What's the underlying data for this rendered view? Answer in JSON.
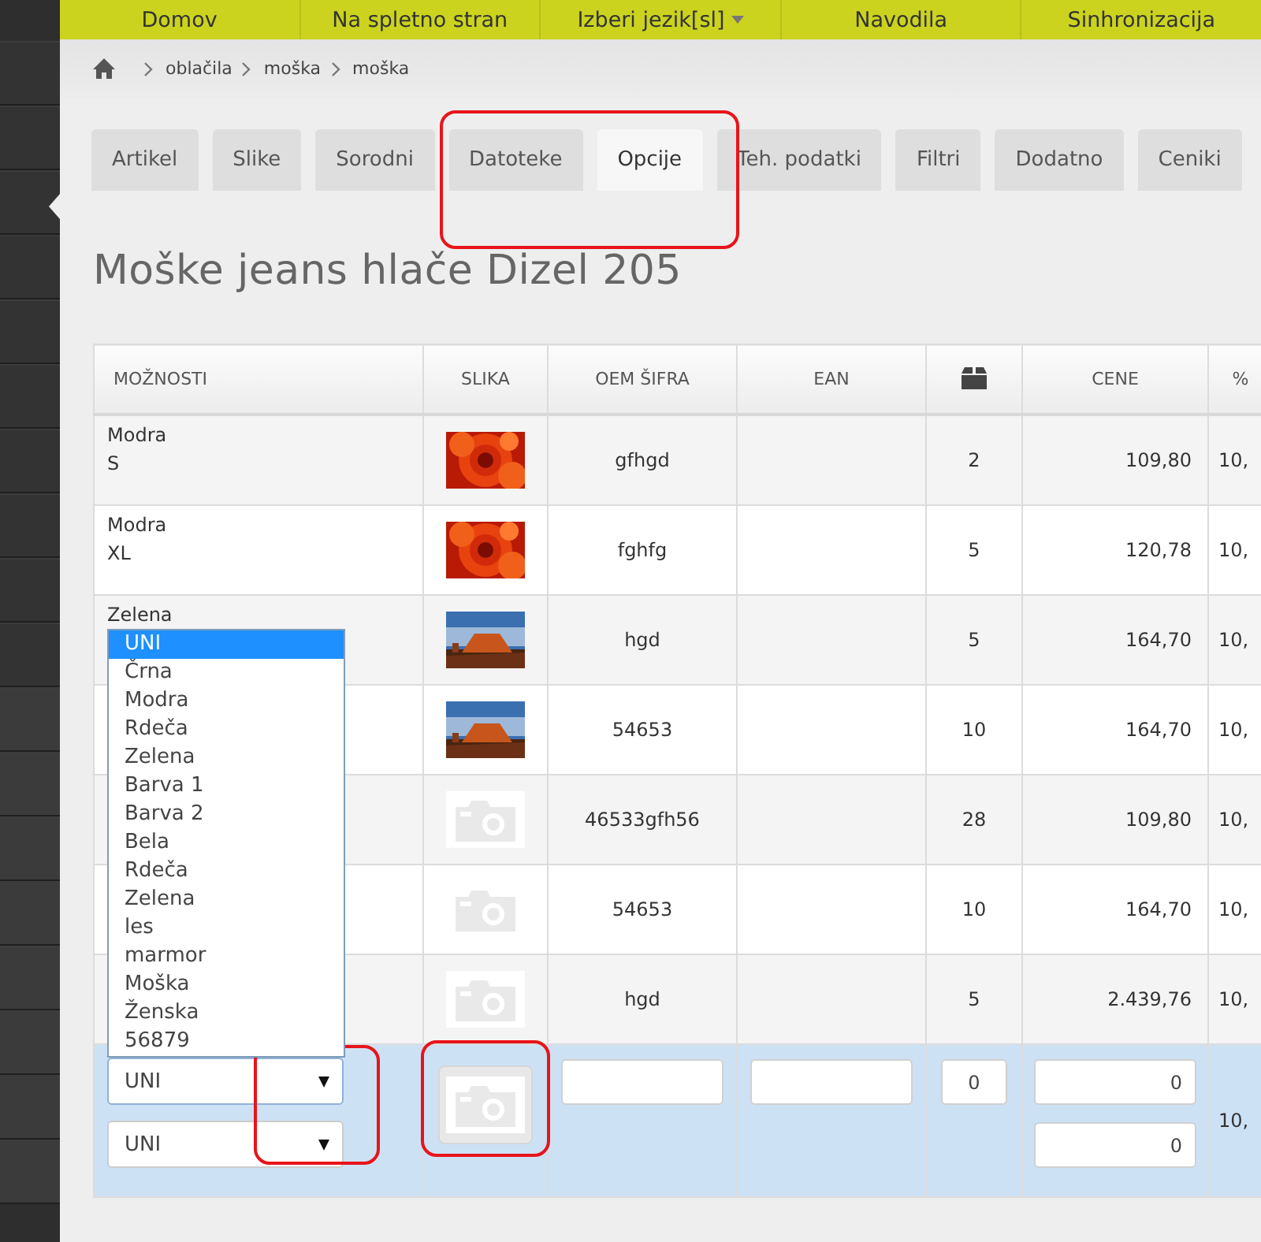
{
  "nav": [
    {
      "label": "Domov",
      "dropdown": false
    },
    {
      "label": "Na spletno stran",
      "dropdown": false
    },
    {
      "label": "Izberi jezik[sl]",
      "dropdown": true
    },
    {
      "label": "Navodila",
      "dropdown": false
    },
    {
      "label": "Sinhronizacija",
      "dropdown": false
    }
  ],
  "breadcrumb": [
    "oblačila",
    "moška",
    "moška"
  ],
  "tabs": [
    {
      "label": "Artikel",
      "selected": false,
      "highlighted": false
    },
    {
      "label": "Slike",
      "selected": false,
      "highlighted": false
    },
    {
      "label": "Sorodni",
      "selected": false,
      "highlighted": false
    },
    {
      "label": "Datoteke",
      "selected": false,
      "highlighted": true
    },
    {
      "label": "Opcije",
      "selected": true,
      "highlighted": false
    },
    {
      "label": "Teh. podatki",
      "selected": false,
      "highlighted": false
    },
    {
      "label": "Filtri",
      "selected": false,
      "highlighted": false
    },
    {
      "label": "Dodatno",
      "selected": false,
      "highlighted": false
    },
    {
      "label": "Ceniki",
      "selected": false,
      "highlighted": false
    }
  ],
  "title": "Moške jeans hlače Dizel 205",
  "table": {
    "columns": [
      {
        "kind": "text",
        "label": "MOŽNOSTI"
      },
      {
        "kind": "text",
        "label": "SLIKA"
      },
      {
        "kind": "text",
        "label": "OEM ŠIFRA"
      },
      {
        "kind": "text",
        "label": "EAN"
      },
      {
        "kind": "icon"
      },
      {
        "kind": "text",
        "label": "CENE"
      },
      {
        "kind": "text",
        "label": "%"
      }
    ],
    "rows": [
      {
        "options": [
          "Modra",
          "S"
        ],
        "photo": true,
        "oem": "gfhgd",
        "qty": "2",
        "price": "109,80",
        "pct": "10,"
      },
      {
        "options": [
          "Modra",
          "XL"
        ],
        "photo": true,
        "oem": "fghfg",
        "qty": "5",
        "price": "120,78",
        "pct": "10,"
      },
      {
        "options": [
          "Zelena"
        ],
        "photo": true,
        "oem": "hgd",
        "qty": "5",
        "price": "164,70",
        "pct": "10,"
      },
      {
        "photo": true,
        "oem": "54653",
        "qty": "10",
        "price": "164,70",
        "pct": "10,"
      },
      {
        "photo": false,
        "oem": "46533gfh56",
        "qty": "28",
        "price": "109,80",
        "pct": "10,"
      },
      {
        "photo": false,
        "oem": "54653",
        "qty": "10",
        "price": "164,70",
        "pct": "10,"
      },
      {
        "photo": false,
        "oem": "hgd",
        "qty": "5",
        "price": "2.439,76",
        "pct": "10,"
      }
    ],
    "new_row": {
      "selects": [
        {
          "value": "UNI",
          "open": true,
          "options": [
            {
              "label": "UNI",
              "selected": true
            },
            {
              "label": "Črna",
              "selected": false
            },
            {
              "label": "Modra",
              "selected": false
            },
            {
              "label": "Rdeča",
              "selected": false
            },
            {
              "label": "Zelena",
              "selected": false
            },
            {
              "label": "Barva 1",
              "selected": false
            },
            {
              "label": "Barva 2",
              "selected": false
            },
            {
              "label": "Bela",
              "selected": false
            },
            {
              "label": "Rdeča",
              "selected": false
            },
            {
              "label": "Zelena",
              "selected": false
            },
            {
              "label": "les",
              "selected": false
            },
            {
              "label": "marmor",
              "selected": false
            },
            {
              "label": "Moška",
              "selected": false
            },
            {
              "label": "Ženska",
              "selected": false
            },
            {
              "label": "56879",
              "selected": false
            }
          ]
        },
        {
          "value": "UNI",
          "open": false
        }
      ],
      "selects_highlighted": true,
      "image_highlighted": true,
      "qty": "0",
      "prices": [
        "0",
        "0"
      ],
      "pct": "10,"
    }
  }
}
